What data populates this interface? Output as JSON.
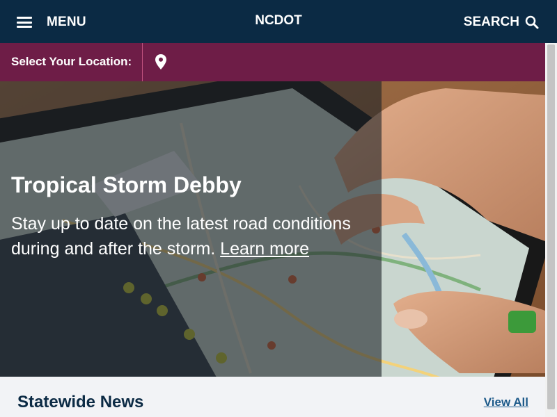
{
  "header": {
    "menu_label": "MENU",
    "site_title": "NCDOT",
    "search_label": "SEARCH",
    "menu_icon": "hamburger-icon",
    "search_icon": "magnifier-icon"
  },
  "location": {
    "label": "Select Your Location:",
    "icon": "map-pin-icon"
  },
  "hero": {
    "title": "Tropical Storm Debby",
    "text": "Stay up to date on the latest road conditions during and after the storm.",
    "link_label": "Learn more",
    "image_desc": "tablet showing traffic map app"
  },
  "news": {
    "title": "Statewide News",
    "view_all_label": "View All"
  },
  "colors": {
    "header_bg": "#0b2a44",
    "location_bg": "#6e1d47",
    "page_bg": "#f2f3f6",
    "link": "#1d5a8a"
  }
}
